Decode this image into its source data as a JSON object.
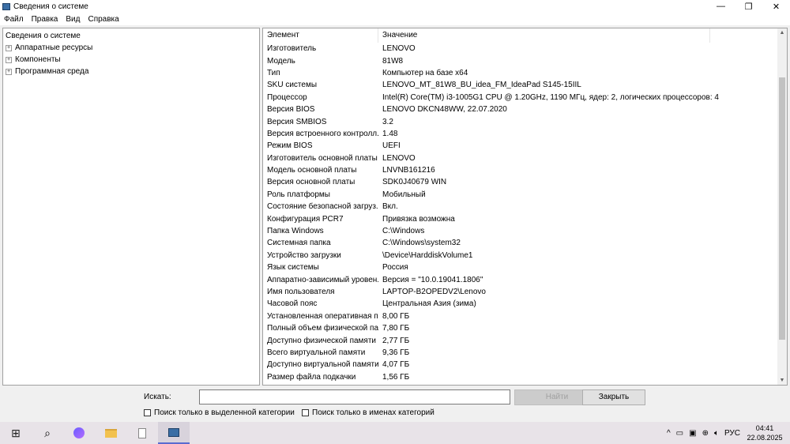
{
  "window": {
    "title": "Сведения о системе",
    "min": "—",
    "max": "❐",
    "close": "✕"
  },
  "menu": [
    "Файл",
    "Правка",
    "Вид",
    "Справка"
  ],
  "tree": {
    "root": "Сведения о системе",
    "children": [
      "Аппаратные ресурсы",
      "Компоненты",
      "Программная среда"
    ]
  },
  "table": {
    "headers": [
      "Элемент",
      "Значение"
    ],
    "rows": [
      [
        "Изготовитель",
        "LENOVO"
      ],
      [
        "Модель",
        "81W8"
      ],
      [
        "Тип",
        "Компьютер на базе x64"
      ],
      [
        "SKU системы",
        "LENOVO_MT_81W8_BU_idea_FM_IdeaPad S145-15IIL"
      ],
      [
        "Процессор",
        "Intel(R) Core(TM) i3-1005G1 CPU @ 1.20GHz, 1190 МГц, ядер: 2, логических процессоров: 4"
      ],
      [
        "Версия BIOS",
        "LENOVO DKCN48WW, 22.07.2020"
      ],
      [
        "Версия SMBIOS",
        "3.2"
      ],
      [
        "Версия встроенного контролл...",
        "1.48"
      ],
      [
        "Режим BIOS",
        "UEFI"
      ],
      [
        "Изготовитель основной платы",
        "LENOVO"
      ],
      [
        "Модель основной платы",
        "LNVNB161216"
      ],
      [
        "Версия основной платы",
        "SDK0J40679 WIN"
      ],
      [
        "Роль платформы",
        "Мобильный"
      ],
      [
        "Состояние безопасной загруз...",
        "Вкл."
      ],
      [
        "Конфигурация PCR7",
        "Привязка возможна"
      ],
      [
        "Папка Windows",
        "C:\\Windows"
      ],
      [
        "Системная папка",
        "C:\\Windows\\system32"
      ],
      [
        "Устройство загрузки",
        "\\Device\\HarddiskVolume1"
      ],
      [
        "Язык системы",
        "Россия"
      ],
      [
        "Аппаратно-зависимый уровен...",
        "Версия = \"10.0.19041.1806\""
      ],
      [
        "Имя пользователя",
        "LAPTOP-B2OPEDV2\\Lenovo"
      ],
      [
        "Часовой пояс",
        "Центральная Азия (зима)"
      ],
      [
        "Установленная оперативная п...",
        "8,00 ГБ"
      ],
      [
        "Полный объем физической па...",
        "7,80 ГБ"
      ],
      [
        "Доступно физической памяти",
        "2,77 ГБ"
      ],
      [
        "Всего виртуальной памяти",
        "9,36 ГБ"
      ],
      [
        "Доступно виртуальной памяти",
        "4,07 ГБ"
      ],
      [
        "Размер файла подкачки",
        "1,56 ГБ"
      ]
    ]
  },
  "search": {
    "label": "Искать:",
    "value": "",
    "find": "Найти",
    "close": "Закрыть",
    "opt1": "Поиск только в выделенной категории",
    "opt2": "Поиск только в именах категорий"
  },
  "tray": {
    "lang": "РУС",
    "time": "04:41",
    "date": "22.08.2025"
  }
}
